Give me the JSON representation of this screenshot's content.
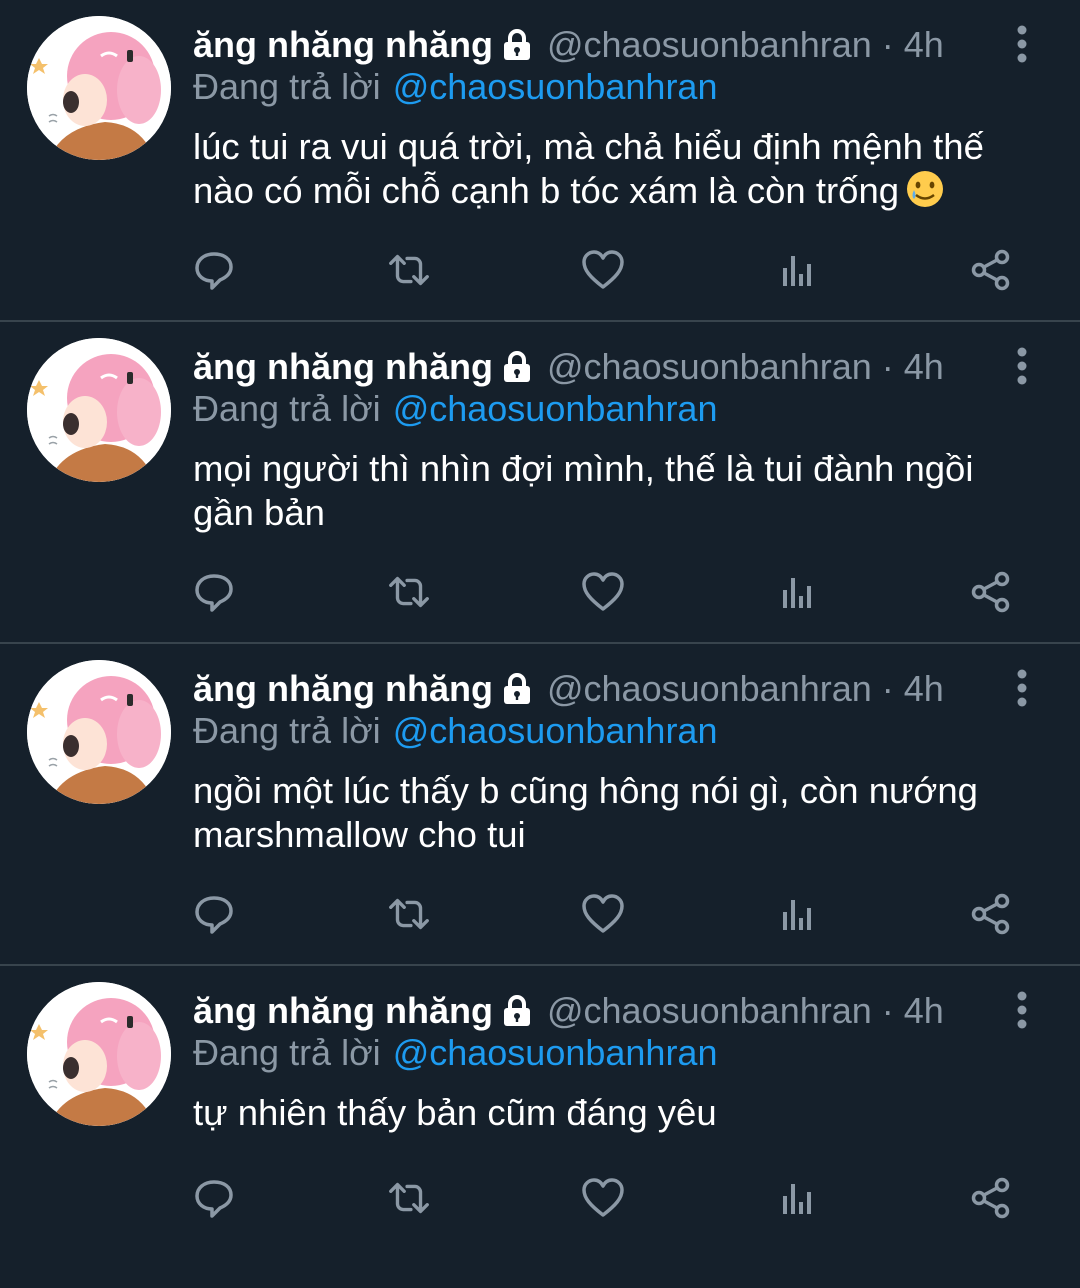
{
  "colors": {
    "background": "#15202b",
    "text": "#ffffff",
    "secondary": "#8b98a5",
    "mention": "#1d9bf0",
    "divider": "#38444d"
  },
  "icons": {
    "lock": "lock-icon",
    "more": "more-vertical-icon",
    "reply": "reply-icon",
    "retweet": "retweet-icon",
    "like": "heart-icon",
    "analytics": "analytics-icon",
    "share": "share-icon",
    "emoji": "smiling-face-with-tear-emoji"
  },
  "tweets": [
    {
      "name": "ăng nhăng nhăng",
      "handle": "@chaosuonbanhran",
      "separator": "·",
      "time": "4h",
      "replying_label": "Đang trả lời",
      "replying_to": "@chaosuonbanhran",
      "text": "lúc tui ra vui quá trời, mà chả hiểu định mệnh thế nào có mỗi chỗ cạnh b tóc xám là còn trống",
      "has_emoji": true
    },
    {
      "name": "ăng nhăng nhăng",
      "handle": "@chaosuonbanhran",
      "separator": "·",
      "time": "4h",
      "replying_label": "Đang trả lời",
      "replying_to": "@chaosuonbanhran",
      "text": "mọi người thì nhìn đợi mình, thế là tui đành ngồi gần bản",
      "has_emoji": false
    },
    {
      "name": "ăng nhăng nhăng",
      "handle": "@chaosuonbanhran",
      "separator": "·",
      "time": "4h",
      "replying_label": "Đang trả lời",
      "replying_to": "@chaosuonbanhran",
      "text": "ngồi một lúc thấy b cũng hông nói gì, còn nướng marshmallow cho tui",
      "has_emoji": false
    },
    {
      "name": "ăng nhăng nhăng",
      "handle": "@chaosuonbanhran",
      "separator": "·",
      "time": "4h",
      "replying_label": "Đang trả lời",
      "replying_to": "@chaosuonbanhran",
      "text": "tự nhiên thấy bản cũm đáng yêu",
      "has_emoji": false
    }
  ]
}
